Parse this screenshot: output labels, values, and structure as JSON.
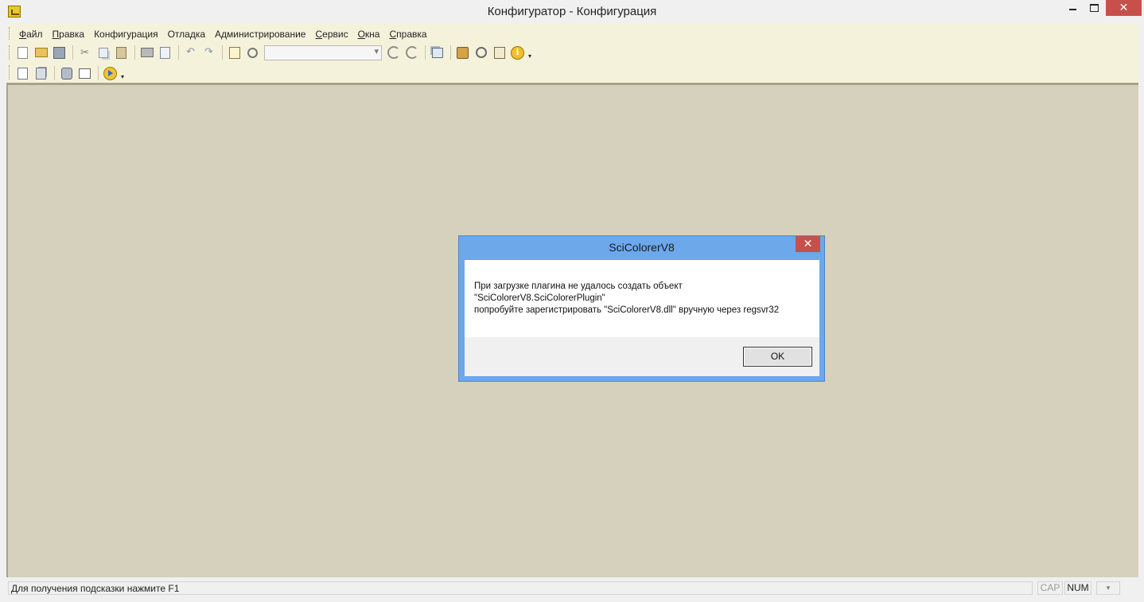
{
  "window": {
    "title": "Конфигуратор - Конфигурация",
    "close_glyph": "✕"
  },
  "menu": [
    {
      "hot": "Ф",
      "rest": "айл"
    },
    {
      "hot": "П",
      "rest": "равка"
    },
    {
      "hot": "",
      "rest": "Конфигурация"
    },
    {
      "hot": "",
      "rest": "Отладка"
    },
    {
      "hot": "",
      "rest": "Администрирование"
    },
    {
      "hot": "С",
      "rest": "ервис"
    },
    {
      "hot": "О",
      "rest": "кна"
    },
    {
      "hot": "С",
      "rest": "правка"
    }
  ],
  "toolbar": {
    "combo_value": "",
    "info_glyph": "i",
    "dropdown_glyph": "▾",
    "cut_glyph": "✂",
    "undo_glyph": "↶",
    "redo_glyph": "↷"
  },
  "dialog": {
    "title": "SciColorerV8",
    "close_glyph": "✕",
    "message_lines": [
      "При загрузке плагина не удалось создать объект",
      "\"SciColorerV8.SciColorerPlugin\"",
      "попробуйте зарегистрировать \"SciColorerV8.dll\" вручную через regsvr32"
    ],
    "ok_label": "OK"
  },
  "status": {
    "hint": "Для получения подсказки нажмите F1",
    "cap": "CAP",
    "num": "NUM",
    "lang_glyph": "▾"
  },
  "colors": {
    "workspace": "#d6d1bc",
    "toolbar": "#f5f2dc",
    "dialog_frame": "#6da8ea",
    "close_red": "#c7504b"
  }
}
